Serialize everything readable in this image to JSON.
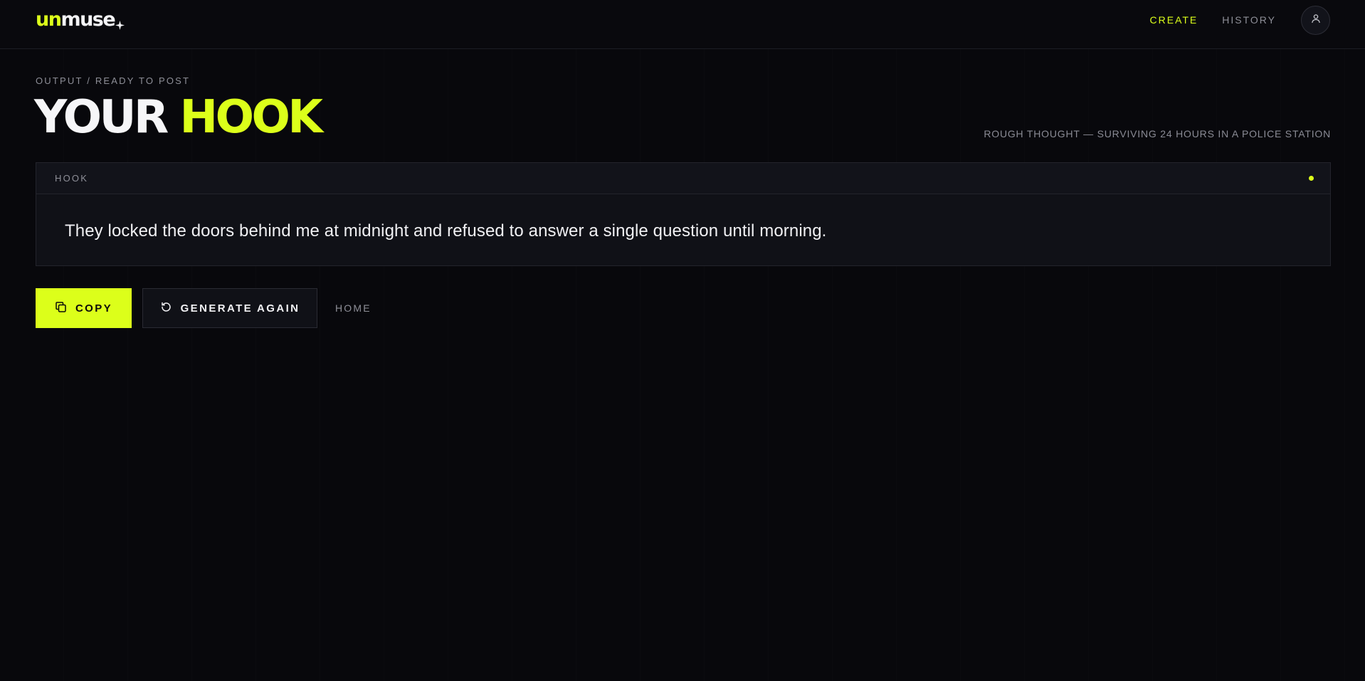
{
  "app": {
    "logo_lead": "un",
    "logo_rest": "muse"
  },
  "nav": {
    "create": "CREATE",
    "history": "HISTORY"
  },
  "page": {
    "breadcrumb": "OUTPUT / READY TO POST",
    "title_part1": "YOUR",
    "title_part2": "HOOK",
    "context": "ROUGH THOUGHT — SURVIVING 24 HOURS IN A POLICE STATION"
  },
  "card": {
    "label": "HOOK",
    "text": "They locked the doors behind me at midnight and refused to answer a single question until morning."
  },
  "actions": {
    "copy_label": "COPY",
    "regenerate_label": "GENERATE AGAIN",
    "home_label": "HOME"
  },
  "icons": {
    "logo": "sparkle-icon",
    "avatar": "user-icon",
    "copy": "copy-icon",
    "regenerate": "refresh-icon",
    "status": "status-dot"
  },
  "colors": {
    "accent": "#dcff1a",
    "background": "#08080c",
    "card": "#101117",
    "muted_text": "#8e8f98"
  }
}
